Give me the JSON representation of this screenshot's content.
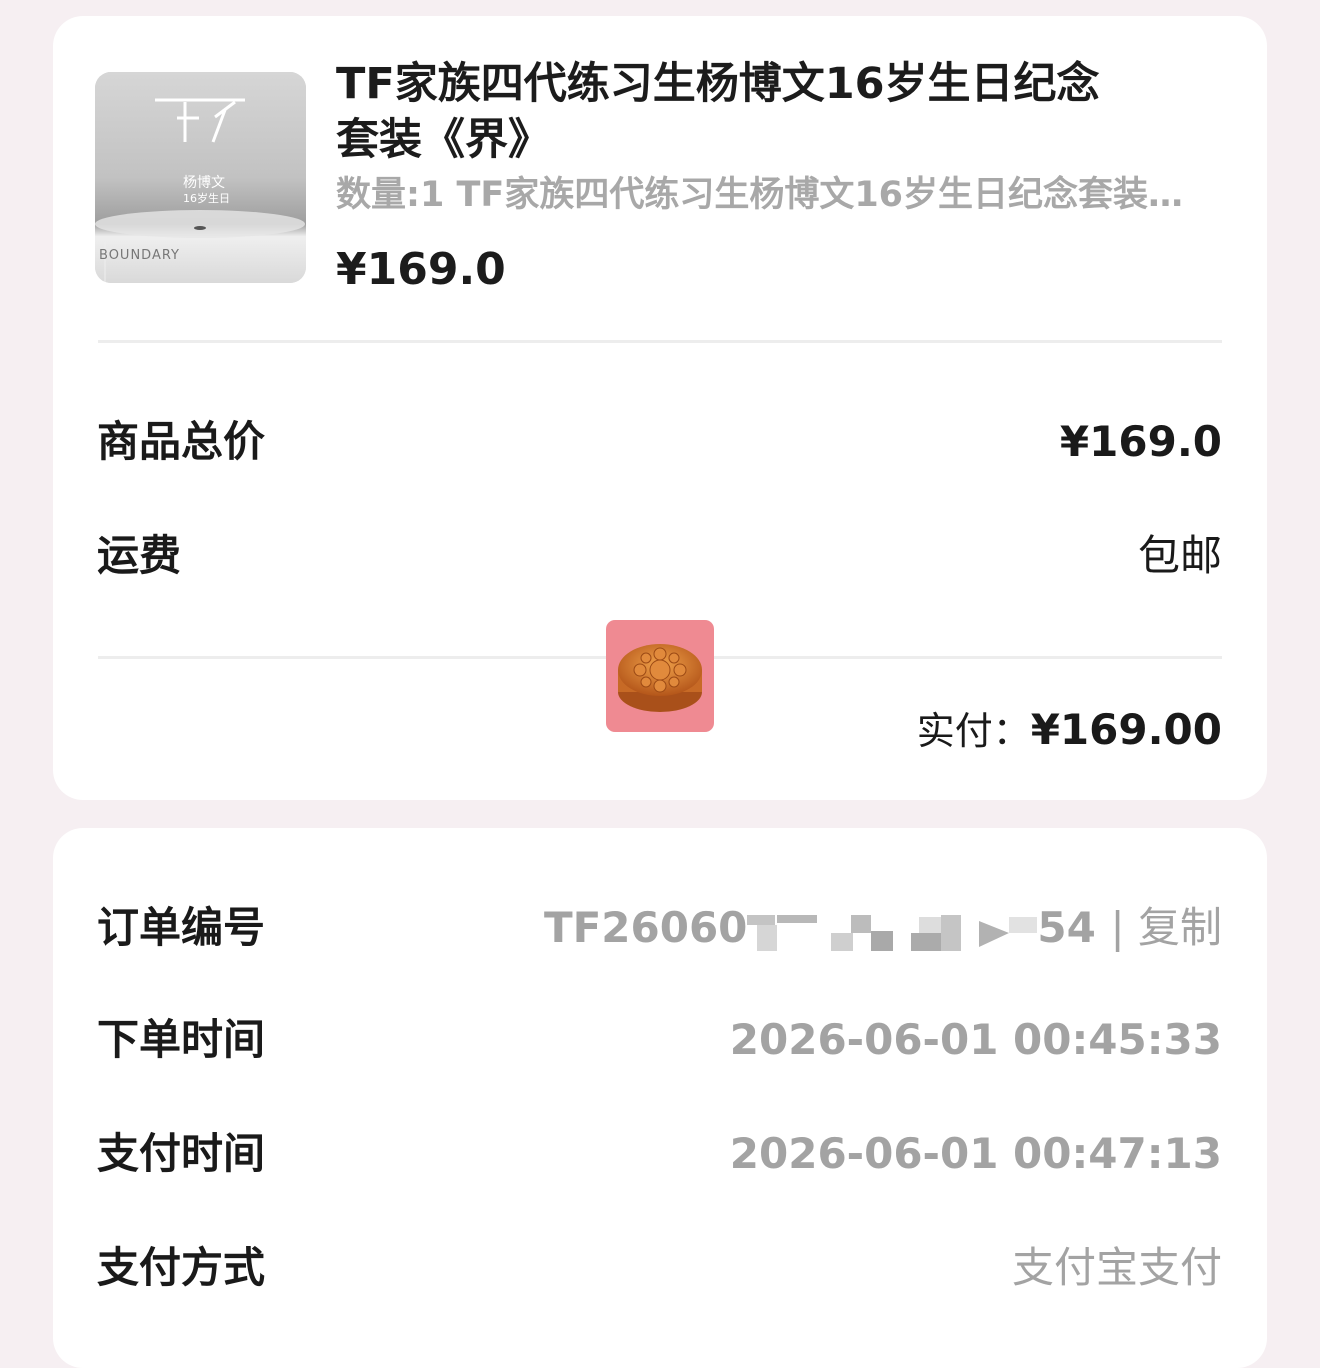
{
  "product": {
    "image": {
      "title_chars": "界",
      "name": "杨博文",
      "sub": "16岁生日",
      "corner_text": "BOUNDARY"
    },
    "title": "TF家族四代练习生杨博文16岁生日纪念套装《界》",
    "description": "数量:1 TF家族四代练习生杨博文16岁生日纪念套装…",
    "price": "¥169.0"
  },
  "summary": {
    "subtotal_label": "商品总价",
    "subtotal_value": "¥169.0",
    "shipping_label": "运费",
    "shipping_value": "包邮",
    "paid_label": "实付：",
    "paid_value": "¥169.00"
  },
  "sticker": {
    "icon": "mooncake-icon"
  },
  "order": {
    "order_no_label": "订单编号",
    "order_no_prefix": "TF26060",
    "order_no_suffix": "54",
    "copy_label": "| 复制",
    "order_time_label": "下单时间",
    "order_time_value": "2026-06-01 00:45:33",
    "pay_time_label": "支付时间",
    "pay_time_value": "2026-06-01 00:47:13",
    "pay_method_label": "支付方式",
    "pay_method_value": "支付宝支付"
  }
}
